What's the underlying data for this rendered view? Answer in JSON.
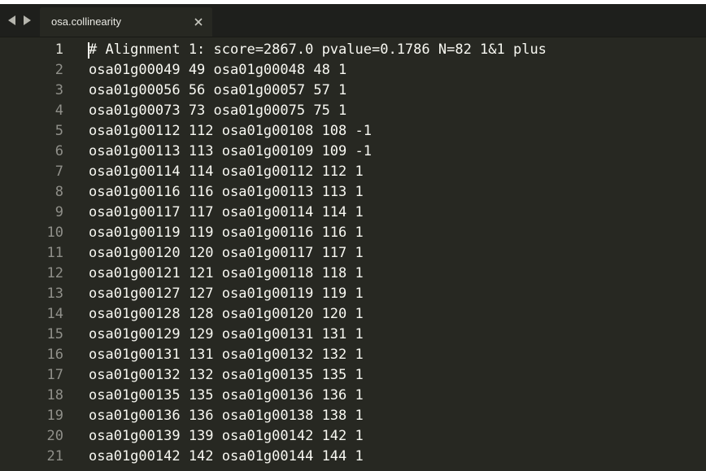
{
  "tab": {
    "title": "osa.collinearity"
  },
  "icons": {
    "nav_back": "triangle-left-icon",
    "nav_forward": "triangle-right-icon",
    "tab_close": "close-icon"
  },
  "colors": {
    "editor_bg": "#272822",
    "tabbar_bg": "#1e1f1c",
    "text": "#f8f8f2",
    "gutter_text": "#90908a"
  },
  "lines": [
    {
      "num": "1",
      "text": "# Alignment 1: score=2867.0 pvalue=0.1786 N=82 1&1 plus"
    },
    {
      "num": "2",
      "text": "osa01g00049 49 osa01g00048 48 1"
    },
    {
      "num": "3",
      "text": "osa01g00056 56 osa01g00057 57 1"
    },
    {
      "num": "4",
      "text": "osa01g00073 73 osa01g00075 75 1"
    },
    {
      "num": "5",
      "text": "osa01g00112 112 osa01g00108 108 -1"
    },
    {
      "num": "6",
      "text": "osa01g00113 113 osa01g00109 109 -1"
    },
    {
      "num": "7",
      "text": "osa01g00114 114 osa01g00112 112 1"
    },
    {
      "num": "8",
      "text": "osa01g00116 116 osa01g00113 113 1"
    },
    {
      "num": "9",
      "text": "osa01g00117 117 osa01g00114 114 1"
    },
    {
      "num": "10",
      "text": "osa01g00119 119 osa01g00116 116 1"
    },
    {
      "num": "11",
      "text": "osa01g00120 120 osa01g00117 117 1"
    },
    {
      "num": "12",
      "text": "osa01g00121 121 osa01g00118 118 1"
    },
    {
      "num": "13",
      "text": "osa01g00127 127 osa01g00119 119 1"
    },
    {
      "num": "14",
      "text": "osa01g00128 128 osa01g00120 120 1"
    },
    {
      "num": "15",
      "text": "osa01g00129 129 osa01g00131 131 1"
    },
    {
      "num": "16",
      "text": "osa01g00131 131 osa01g00132 132 1"
    },
    {
      "num": "17",
      "text": "osa01g00132 132 osa01g00135 135 1"
    },
    {
      "num": "18",
      "text": "osa01g00135 135 osa01g00136 136 1"
    },
    {
      "num": "19",
      "text": "osa01g00136 136 osa01g00138 138 1"
    },
    {
      "num": "20",
      "text": "osa01g00139 139 osa01g00142 142 1"
    },
    {
      "num": "21",
      "text": "osa01g00142 142 osa01g00144 144 1"
    }
  ]
}
